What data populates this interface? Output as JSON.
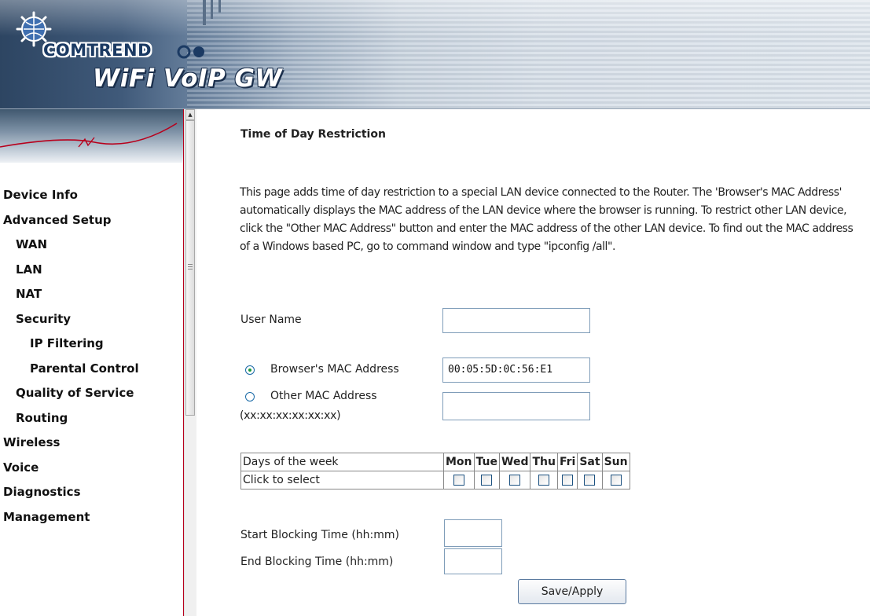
{
  "header": {
    "brand": "COMTREND",
    "product": "WiFi VoIP GW"
  },
  "sidebar": {
    "items": [
      {
        "label": "Device Info",
        "level": 0
      },
      {
        "label": "Advanced Setup",
        "level": 0
      },
      {
        "label": "WAN",
        "level": 1
      },
      {
        "label": "LAN",
        "level": 1
      },
      {
        "label": "NAT",
        "level": 1
      },
      {
        "label": "Security",
        "level": 1
      },
      {
        "label": "IP Filtering",
        "level": 2
      },
      {
        "label": "Parental Control",
        "level": 2
      },
      {
        "label": "Quality of Service",
        "level": 1
      },
      {
        "label": "Routing",
        "level": 1
      },
      {
        "label": "Wireless",
        "level": 0
      },
      {
        "label": "Voice",
        "level": 0
      },
      {
        "label": "Diagnostics",
        "level": 0
      },
      {
        "label": "Management",
        "level": 0
      }
    ]
  },
  "page": {
    "title": "Time of Day Restriction",
    "description": "This page adds time of day restriction to a special LAN device connected to the Router. The 'Browser's MAC Address' automatically displays the MAC address of the LAN device where the browser is running. To restrict other LAN device, click the \"Other MAC Address\" button and enter the MAC address of the other LAN device. To find out the MAC address of a Windows based PC, go to command window and type \"ipconfig /all\".",
    "user_name_label": "User Name",
    "user_name_value": "",
    "browser_mac_label": "Browser's MAC Address",
    "browser_mac_value": "00:05:5D:0C:56:E1",
    "browser_mac_selected": true,
    "other_mac_label": "Other MAC Address",
    "other_mac_format": "(xx:xx:xx:xx:xx:xx)",
    "other_mac_value": "",
    "days_header": "Days of the week",
    "days_row_label": "Click to select",
    "days": [
      "Mon",
      "Tue",
      "Wed",
      "Thu",
      "Fri",
      "Sat",
      "Sun"
    ],
    "start_label": "Start Blocking Time (hh:mm)",
    "start_value": "",
    "end_label": "End Blocking Time (hh:mm)",
    "end_value": "",
    "save_label": "Save/Apply"
  }
}
